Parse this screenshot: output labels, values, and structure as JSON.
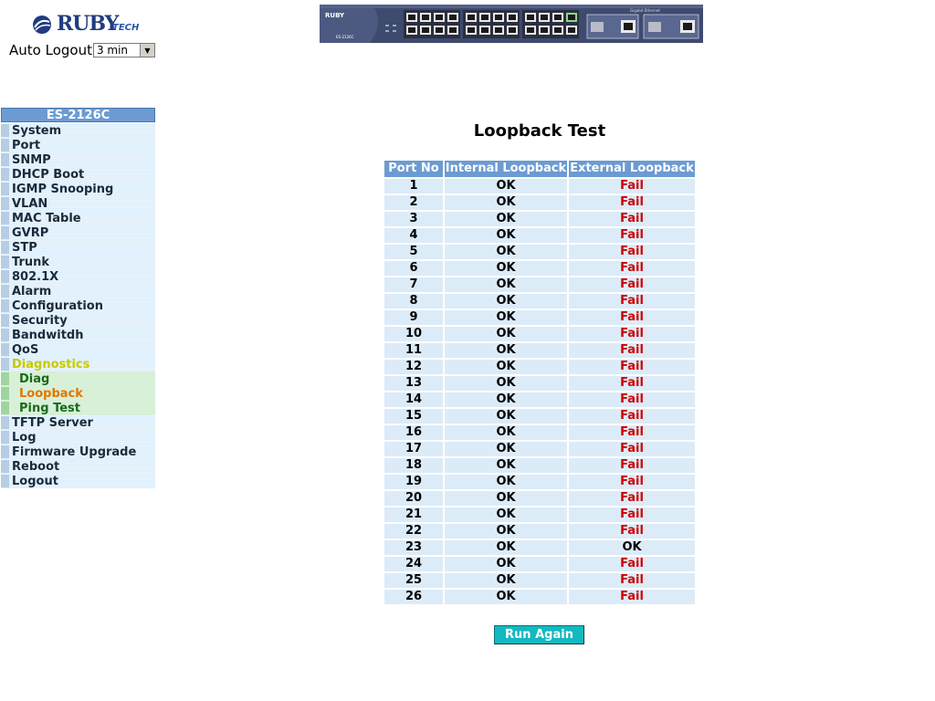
{
  "header": {
    "brand": "RUBY",
    "brand_suffix": "TECH",
    "auto_logout_label": "Auto Logout",
    "auto_logout_value": "3 min"
  },
  "device": {
    "label_left": "RUBY",
    "label_right": "Gigabit Ethernet",
    "model_small": "ES-2126C"
  },
  "sidebar": {
    "title": "ES-2126C",
    "items": [
      {
        "label": "System"
      },
      {
        "label": "Port"
      },
      {
        "label": "SNMP"
      },
      {
        "label": "DHCP Boot"
      },
      {
        "label": "IGMP Snooping"
      },
      {
        "label": "VLAN"
      },
      {
        "label": "MAC Table"
      },
      {
        "label": "GVRP"
      },
      {
        "label": "STP"
      },
      {
        "label": "Trunk"
      },
      {
        "label": "802.1X"
      },
      {
        "label": "Alarm"
      },
      {
        "label": "Configuration"
      },
      {
        "label": "Security"
      },
      {
        "label": "Bandwitdh"
      },
      {
        "label": "QoS"
      },
      {
        "label": "Diagnostics"
      },
      {
        "label": "Diag"
      },
      {
        "label": "Loopback"
      },
      {
        "label": "Ping Test"
      },
      {
        "label": "TFTP Server"
      },
      {
        "label": "Log"
      },
      {
        "label": "Firmware Upgrade"
      },
      {
        "label": "Reboot"
      },
      {
        "label": "Logout"
      }
    ]
  },
  "main": {
    "title": "Loopback Test",
    "columns": [
      "Port No",
      "Internal Loopback",
      "External Loopback"
    ],
    "rows": [
      [
        "1",
        "OK",
        "Fail"
      ],
      [
        "2",
        "OK",
        "Fail"
      ],
      [
        "3",
        "OK",
        "Fail"
      ],
      [
        "4",
        "OK",
        "Fail"
      ],
      [
        "5",
        "OK",
        "Fail"
      ],
      [
        "6",
        "OK",
        "Fail"
      ],
      [
        "7",
        "OK",
        "Fail"
      ],
      [
        "8",
        "OK",
        "Fail"
      ],
      [
        "9",
        "OK",
        "Fail"
      ],
      [
        "10",
        "OK",
        "Fail"
      ],
      [
        "11",
        "OK",
        "Fail"
      ],
      [
        "12",
        "OK",
        "Fail"
      ],
      [
        "13",
        "OK",
        "Fail"
      ],
      [
        "14",
        "OK",
        "Fail"
      ],
      [
        "15",
        "OK",
        "Fail"
      ],
      [
        "16",
        "OK",
        "Fail"
      ],
      [
        "17",
        "OK",
        "Fail"
      ],
      [
        "18",
        "OK",
        "Fail"
      ],
      [
        "19",
        "OK",
        "Fail"
      ],
      [
        "20",
        "OK",
        "Fail"
      ],
      [
        "21",
        "OK",
        "Fail"
      ],
      [
        "22",
        "OK",
        "Fail"
      ],
      [
        "23",
        "OK",
        "OK"
      ],
      [
        "24",
        "OK",
        "Fail"
      ],
      [
        "25",
        "OK",
        "Fail"
      ],
      [
        "26",
        "OK",
        "Fail"
      ]
    ],
    "run_again_label": "Run Again"
  },
  "colors": {
    "header_blue": "#6b9bd2",
    "row_bg": "#dcebf8",
    "fail_red": "#cc0000",
    "button_teal": "#14b8c0",
    "active_yellow": "#c8c800",
    "current_orange": "#e07800"
  }
}
